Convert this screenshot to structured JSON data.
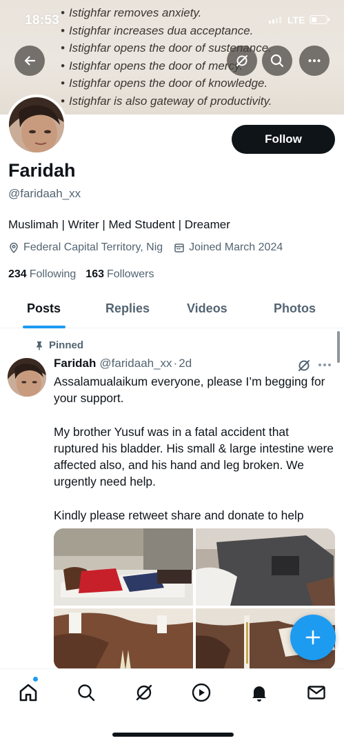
{
  "status_bar": {
    "time": "18:53",
    "network": "LTE",
    "battery_level": 0.3
  },
  "banner": {
    "lines": [
      "Istighfar removes anxiety.",
      "Istighfar increases dua acceptance.",
      "Istighfar opens the door of sustenance.",
      "Istighfar opens the door of mercy.",
      "Istighfar opens the door of knowledge.",
      "Istighfar is also gateway of productivity."
    ],
    "bullet": "•"
  },
  "header": {
    "back_icon": "arrow-left-icon",
    "grok_icon": "grok-icon",
    "search_icon": "search-icon",
    "more_icon": "more-icon"
  },
  "profile": {
    "follow_label": "Follow",
    "name": "Faridah",
    "handle": "@faridaah_xx",
    "bio": "Muslimah | Writer | Med Student | Dreamer",
    "location": "Federal Capital Territory, Nig",
    "joined": "Joined March 2024",
    "following_count": "234",
    "following_label": "Following",
    "followers_count": "163",
    "followers_label": "Followers"
  },
  "tabs": [
    {
      "label": "Posts",
      "active": true
    },
    {
      "label": "Replies",
      "active": false
    },
    {
      "label": "Videos",
      "active": false
    },
    {
      "label": "Photos",
      "active": false
    }
  ],
  "post": {
    "pinned_label": "Pinned",
    "author_name": "Faridah",
    "author_handle": "@faridaah_xx",
    "separator": "·",
    "time": "2d",
    "paragraphs": [
      "Assalamualaikum everyone, please I’m begging for your support.",
      "My brother Yusuf was in a fatal accident that ruptured his bladder. His small & large intestine were affected also, and his hand and leg broken. We urgently need help.",
      "Kindly please retweet share and donate to help"
    ],
    "media_count": 4
  },
  "fab_icon": "plus-icon",
  "bottom_nav": [
    {
      "name": "home",
      "icon": "home-icon",
      "active": true,
      "notification": true
    },
    {
      "name": "search",
      "icon": "search-icon"
    },
    {
      "name": "grok",
      "icon": "grok-icon"
    },
    {
      "name": "video",
      "icon": "play-icon"
    },
    {
      "name": "notifications",
      "icon": "bell-icon"
    },
    {
      "name": "messages",
      "icon": "mail-icon"
    }
  ],
  "colors": {
    "accent": "#1d9bf0",
    "text_primary": "#0f1419",
    "text_secondary": "#536471",
    "follow_button": "#0f1419"
  }
}
